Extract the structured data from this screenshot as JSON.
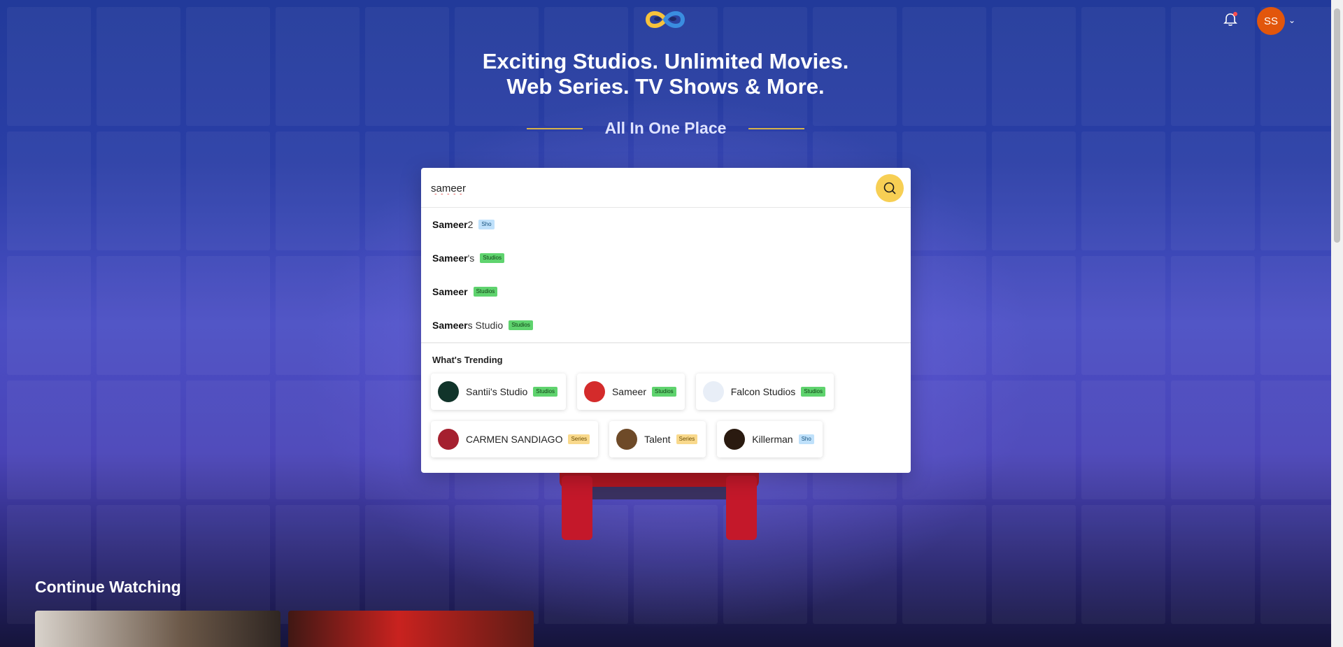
{
  "headline": {
    "line1": "Exciting Studios. Unlimited Movies.",
    "line2": "Web Series. TV Shows & More."
  },
  "tagline": "All In One Place",
  "user": {
    "initials": "SS"
  },
  "search": {
    "value": "sameer",
    "suggestions": [
      {
        "match": "Sameer",
        "rest": "2",
        "tag": "Sho",
        "tag_type": "sho"
      },
      {
        "match": "Sameer",
        "rest": "'s",
        "tag": "Studios",
        "tag_type": "studios"
      },
      {
        "match": "Sameer",
        "rest": "",
        "tag": "Studios",
        "tag_type": "studios"
      },
      {
        "match": "Sameer",
        "rest": "s Studio",
        "tag": "Studios",
        "tag_type": "studios"
      }
    ],
    "trending_title": "What's Trending",
    "trending": [
      {
        "label": "Santii's Studio",
        "tag": "Studios",
        "tag_type": "studios",
        "thumb_color": "#11342a"
      },
      {
        "label": "Sameer",
        "tag": "Studios",
        "tag_type": "studios",
        "thumb_color": "#d42b2b"
      },
      {
        "label": "Falcon Studios",
        "tag": "Studios",
        "tag_type": "studios",
        "thumb_color": "#e8eef7"
      },
      {
        "label": "CARMEN SANDIAGO",
        "tag": "Series",
        "tag_type": "series",
        "thumb_color": "#a5202f"
      },
      {
        "label": "Talent",
        "tag": "Series",
        "tag_type": "series",
        "thumb_color": "#6e4a28"
      },
      {
        "label": "Killerman",
        "tag": "Sho",
        "tag_type": "sho",
        "thumb_color": "#2a1a10"
      }
    ]
  },
  "continue_watching": {
    "title": "Continue Watching"
  },
  "colors": {
    "accent": "#f7cf54",
    "avatar": "#e2560c",
    "studios_tag": "#5fd36e",
    "series_tag": "#f9d98c",
    "sho_tag": "#bfe1fb"
  },
  "icons": {
    "logo": "infinity-eyes-logo",
    "bell": "bell-icon",
    "search": "search-icon",
    "chevron": "chevron-down-icon"
  }
}
